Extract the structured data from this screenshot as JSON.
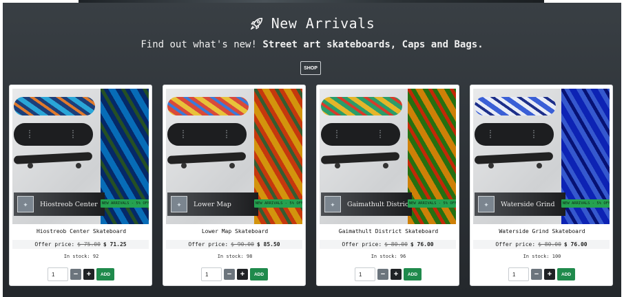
{
  "section": {
    "title": "New Arrivals",
    "subtitle_plain": "Find out what's new!",
    "subtitle_bold": "Street art skateboards, Caps and Bags.",
    "shop_label": "SHOP",
    "icon": "rocket-icon"
  },
  "labels": {
    "offer_price": "Offer price:",
    "in_stock": "In stock:",
    "add": "ADD",
    "minus": "−",
    "plus": "+"
  },
  "products": [
    {
      "name": "Hiostreob Center Skateboard",
      "image_label": "Hiostreob Center",
      "badge": "NEW ARRIVALS - 5% OFF",
      "old_price": "$ 75.00",
      "new_price": "$ 71.25",
      "stock": "92",
      "qty": "1",
      "colors": {
        "a": "#2aa6d8",
        "b": "#1c3f7a",
        "c": "#e07a2c"
      }
    },
    {
      "name": "Lower Map Skateboard",
      "image_label": "Lower Map",
      "badge": "NEW ARRIVALS - 5% OFF",
      "old_price": "$ 90.00",
      "new_price": "$ 85.50",
      "stock": "98",
      "qty": "1",
      "colors": {
        "a": "#e8c23a",
        "b": "#d94a3a",
        "c": "#3a7ad9"
      }
    },
    {
      "name": "Gaimathult District Skateboard",
      "image_label": "Gaimathult District",
      "badge": "NEW ARRIVALS - 5% OFF",
      "old_price": "$ 80.00",
      "new_price": "$ 76.00",
      "stock": "96",
      "qty": "1",
      "colors": {
        "a": "#e5b52a",
        "b": "#2a9d6a",
        "c": "#d83a2a"
      }
    },
    {
      "name": "Waterside Grind Skateboard",
      "image_label": "Waterside Grind",
      "badge": "NEW ARRIVALS - 5% OFF",
      "old_price": "$ 80.00",
      "new_price": "$ 76.00",
      "stock": "100",
      "qty": "1",
      "colors": {
        "a": "#3a5fd6",
        "b": "#e8ecf6",
        "c": "#1d2f8a"
      }
    }
  ]
}
